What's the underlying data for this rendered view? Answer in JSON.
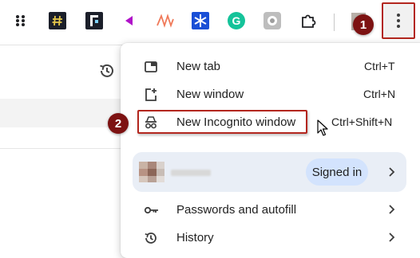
{
  "toolbar": {
    "extensions": [
      {
        "name": "apps-grid-icon"
      },
      {
        "name": "hashtag-extension-icon"
      },
      {
        "name": "bracket-extension-icon"
      },
      {
        "name": "purple-arrow-extension-icon"
      },
      {
        "name": "wave-extension-icon"
      },
      {
        "name": "snowflake-extension-icon"
      },
      {
        "name": "grammarly-icon",
        "text": "G"
      },
      {
        "name": "gray-circle-extension-icon"
      },
      {
        "name": "puzzle-extensions-icon"
      }
    ],
    "menu_button_label": "More"
  },
  "annotations": {
    "step1": "1",
    "step2": "2",
    "highlight_color": "#b3261e",
    "badge_color": "#7d1212"
  },
  "menu": {
    "items": [
      {
        "label": "New tab",
        "shortcut": "Ctrl+T",
        "icon": "new-tab-icon"
      },
      {
        "label": "New window",
        "shortcut": "Ctrl+N",
        "icon": "new-window-icon"
      },
      {
        "label": "New Incognito window",
        "shortcut": "Ctrl+Shift+N",
        "icon": "incognito-icon"
      }
    ],
    "profile": {
      "status": "Signed in"
    },
    "lower_items": [
      {
        "label": "Passwords and autofill",
        "icon": "key-icon"
      },
      {
        "label": "History",
        "icon": "history-icon"
      }
    ]
  }
}
